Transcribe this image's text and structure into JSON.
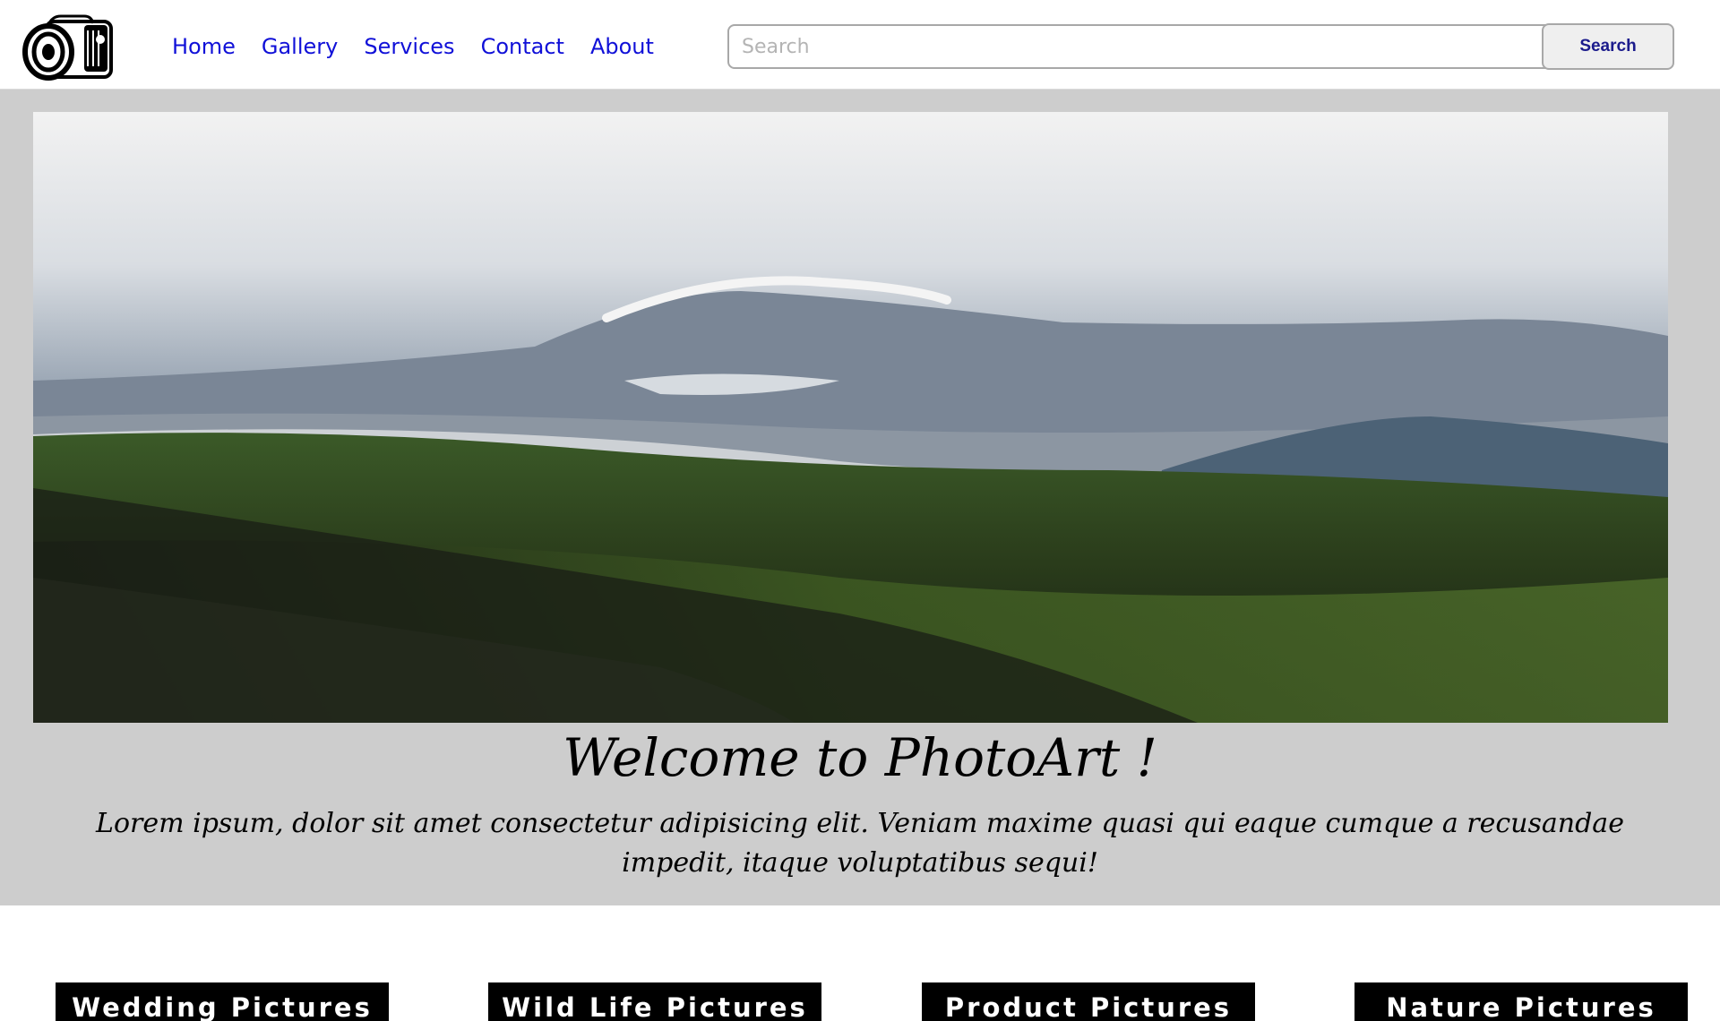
{
  "nav": {
    "items": [
      {
        "label": "Home"
      },
      {
        "label": "Gallery"
      },
      {
        "label": "Services"
      },
      {
        "label": "Contact"
      },
      {
        "label": "About"
      }
    ]
  },
  "search": {
    "placeholder": "Search",
    "value": "",
    "button_label": "Search"
  },
  "hero": {
    "title": "Welcome to PhotoArt !",
    "text": "Lorem ipsum, dolor sit amet consectetur adipisicing elit. Veniam maxime quasi qui eaque cumque a recusandae impedit, itaque voluptatibus sequi!"
  },
  "categories": [
    {
      "label": "Wedding Pictures"
    },
    {
      "label": "Wild Life Pictures"
    },
    {
      "label": "Product Pictures"
    },
    {
      "label": "Nature Pictures"
    }
  ],
  "colors": {
    "nav_link": "#1010d8",
    "hero_band": "#cdcdcd",
    "category_bg": "#000000",
    "category_text": "#ffffff"
  },
  "icons": {
    "logo": "camera-icon"
  }
}
